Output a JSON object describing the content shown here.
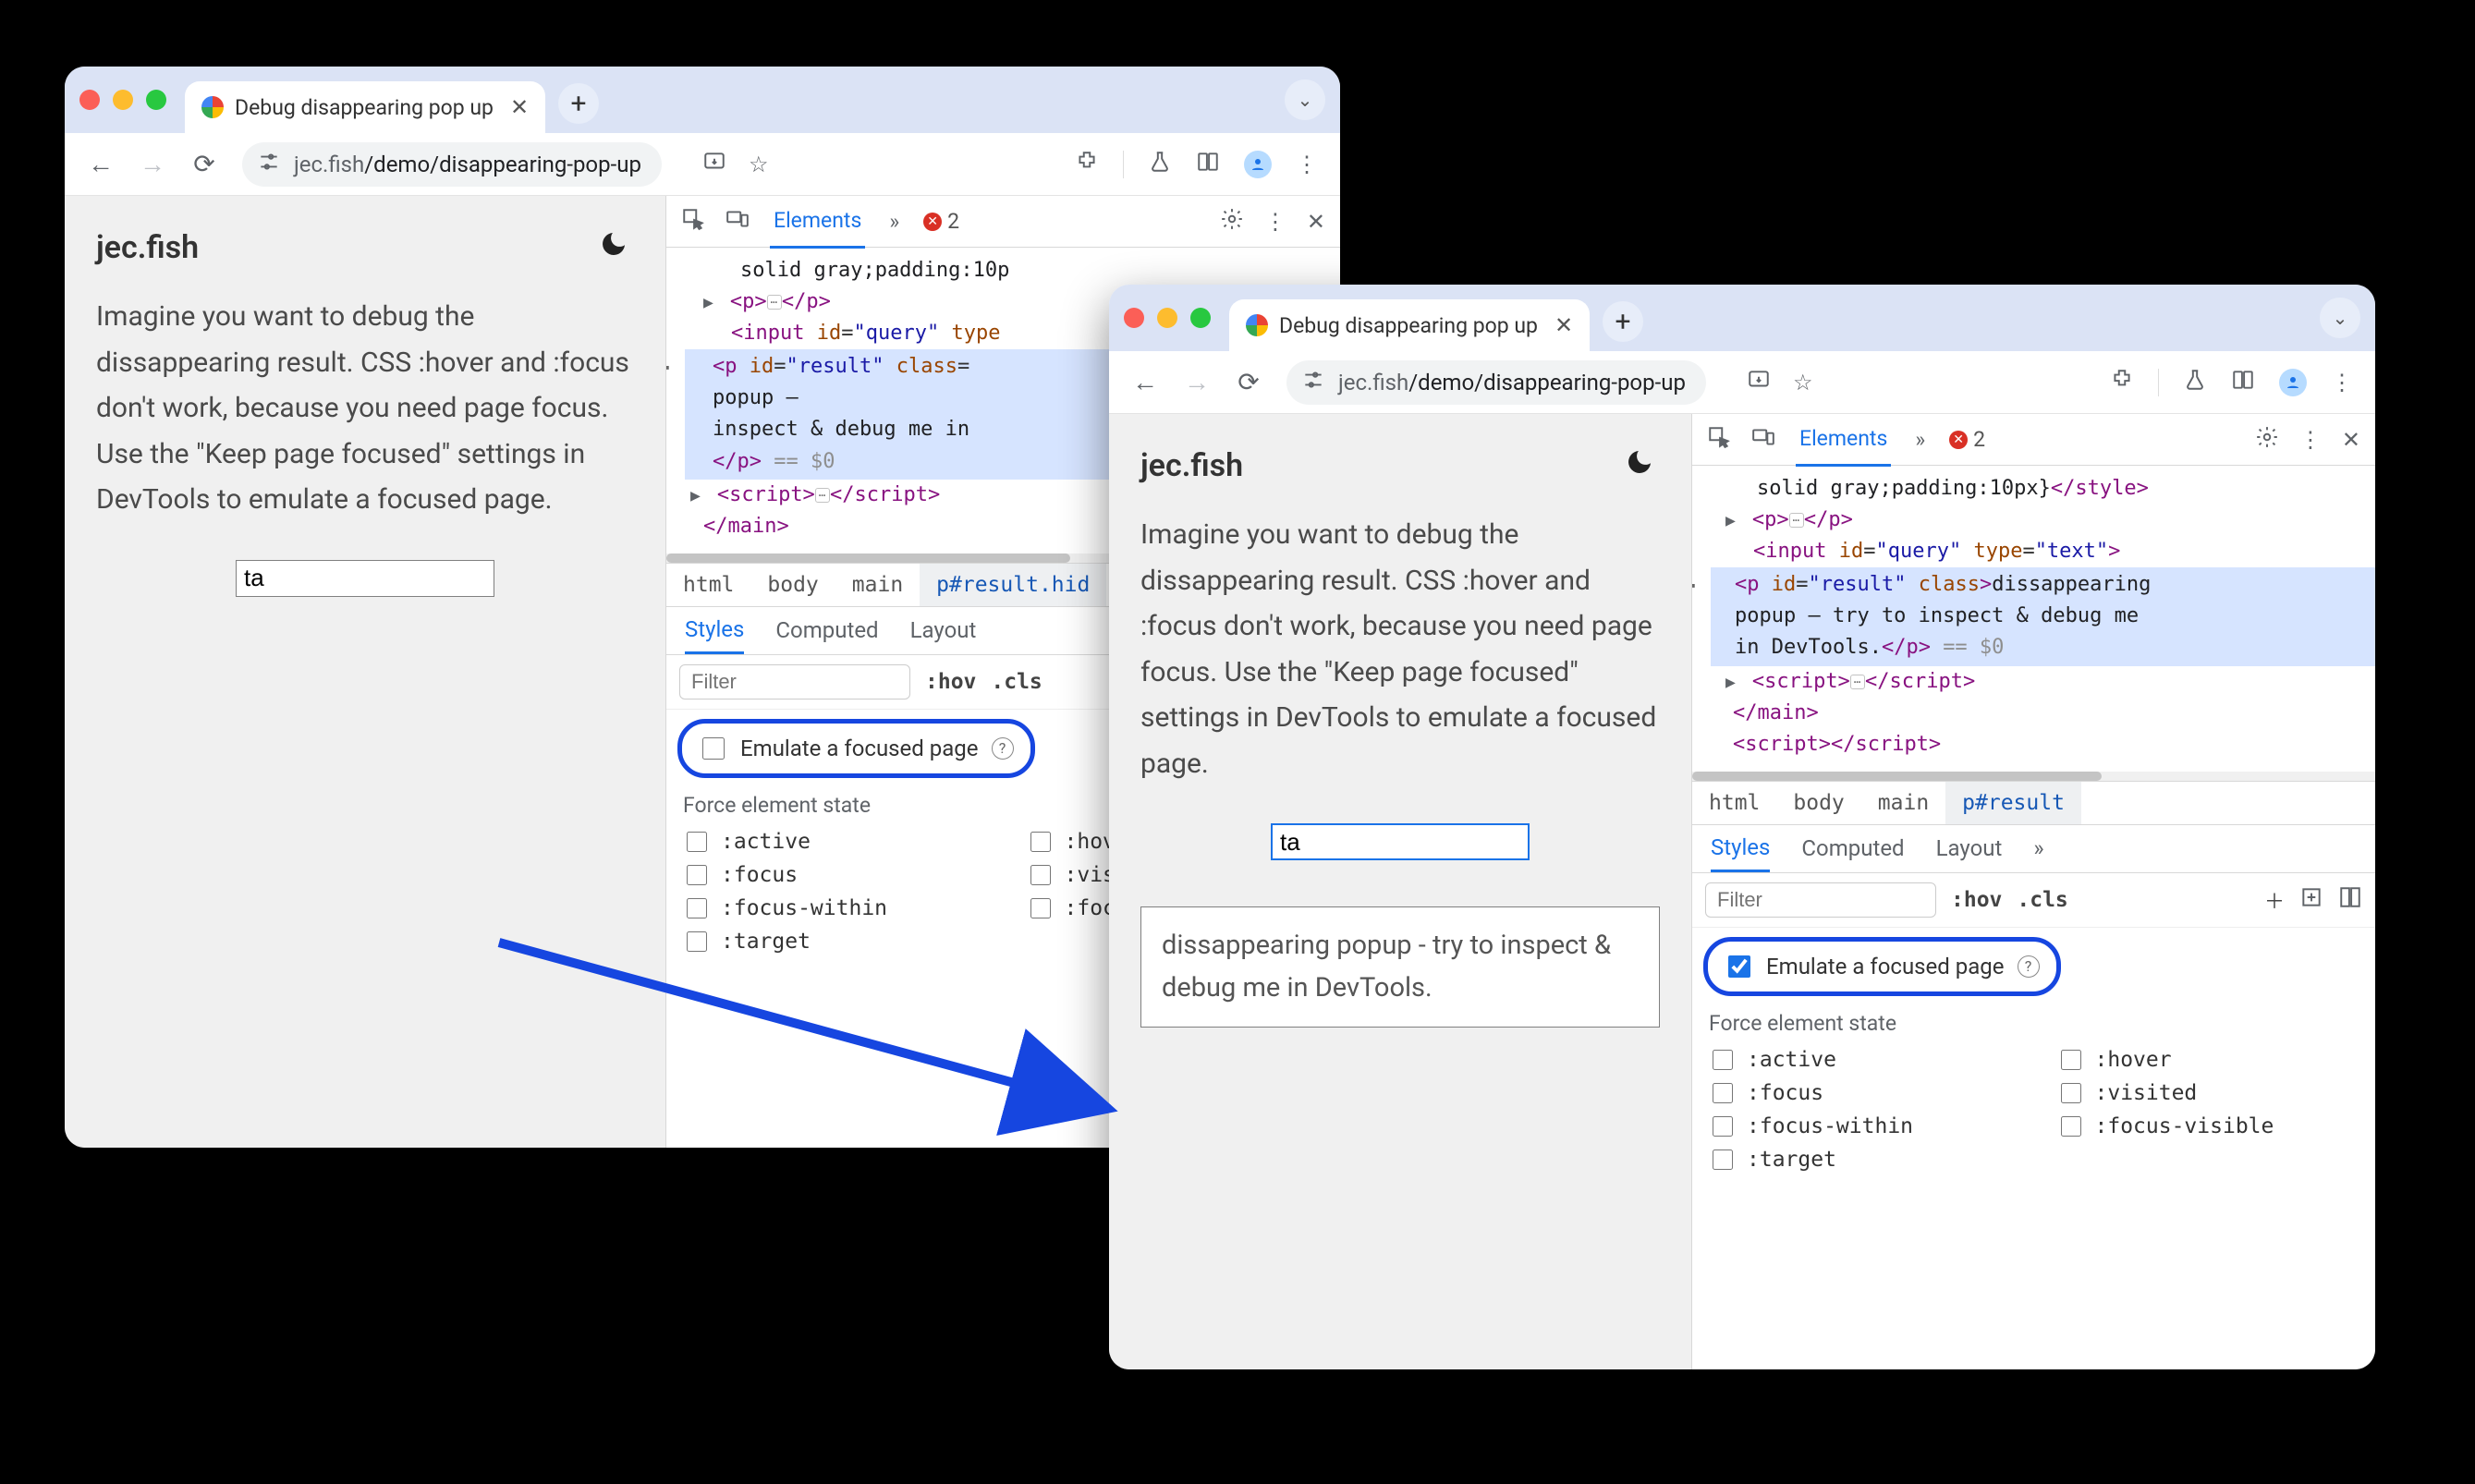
{
  "tab": {
    "title": "Debug disappearing pop up"
  },
  "url": {
    "host": "jec.fish",
    "path": "/demo/disappearing-pop-up"
  },
  "page": {
    "brand": "jec.fish",
    "intro": "Imagine you want to debug the dissappearing result. CSS :hover and :focus don't work, because you need page focus. Use the \"Keep page focused\" settings in DevTools to emulate a focused page.",
    "input_value": "ta",
    "popup_text": "dissappearing popup - try to inspect & debug me in DevTools."
  },
  "devtools": {
    "elements_tab": "Elements",
    "more": "»",
    "error_count": "2",
    "dom": {
      "style_frag": "solid gray;padding:10p",
      "style_frag2": "solid gray;padding:10px}",
      "input_line_pre": "<input id=",
      "input_id": "\"query\"",
      "input_type_attr": "type",
      "input_type_val_short": "\"tex",
      "input_type_val": "\"text\"",
      "p_open_pre": "<p id=",
      "p_id": "\"result\"",
      "p_class_attr": "class",
      "p_class_eq": "=",
      "p_text_a_1": "dissappearing",
      "p_text_a_2": "popup — ",
      "p_text_a_3": "inspect & debug me in ",
      "p_text_b": "dissappearing popup — try to inspect & debug me in DevTools.",
      "p_close": "</p>",
      "eq0": "== $0",
      "script_open": "<script>",
      "script_close": "</﻿script>",
      "main_close": "</main>",
      "style_close": "</style>"
    },
    "breadcrumb": [
      "html",
      "body",
      "main"
    ],
    "breadcrumb_sel_a": "p#result.hid",
    "breadcrumb_sel_b": "p#result",
    "panes": {
      "styles": "Styles",
      "computed": "Computed",
      "layout": "Layout",
      "more": "»"
    },
    "filter_placeholder": "Filter",
    "hov": ":hov",
    "cls": ".cls",
    "emulate_label": "Emulate a focused page",
    "force_state_title": "Force element state",
    "states_col1": [
      ":active",
      ":focus",
      ":focus-within",
      ":target"
    ],
    "states_col2_a": [
      ":hove",
      ":visi",
      ":focu"
    ],
    "states_col2_b": [
      ":hover",
      ":visited",
      ":focus-visible"
    ]
  }
}
